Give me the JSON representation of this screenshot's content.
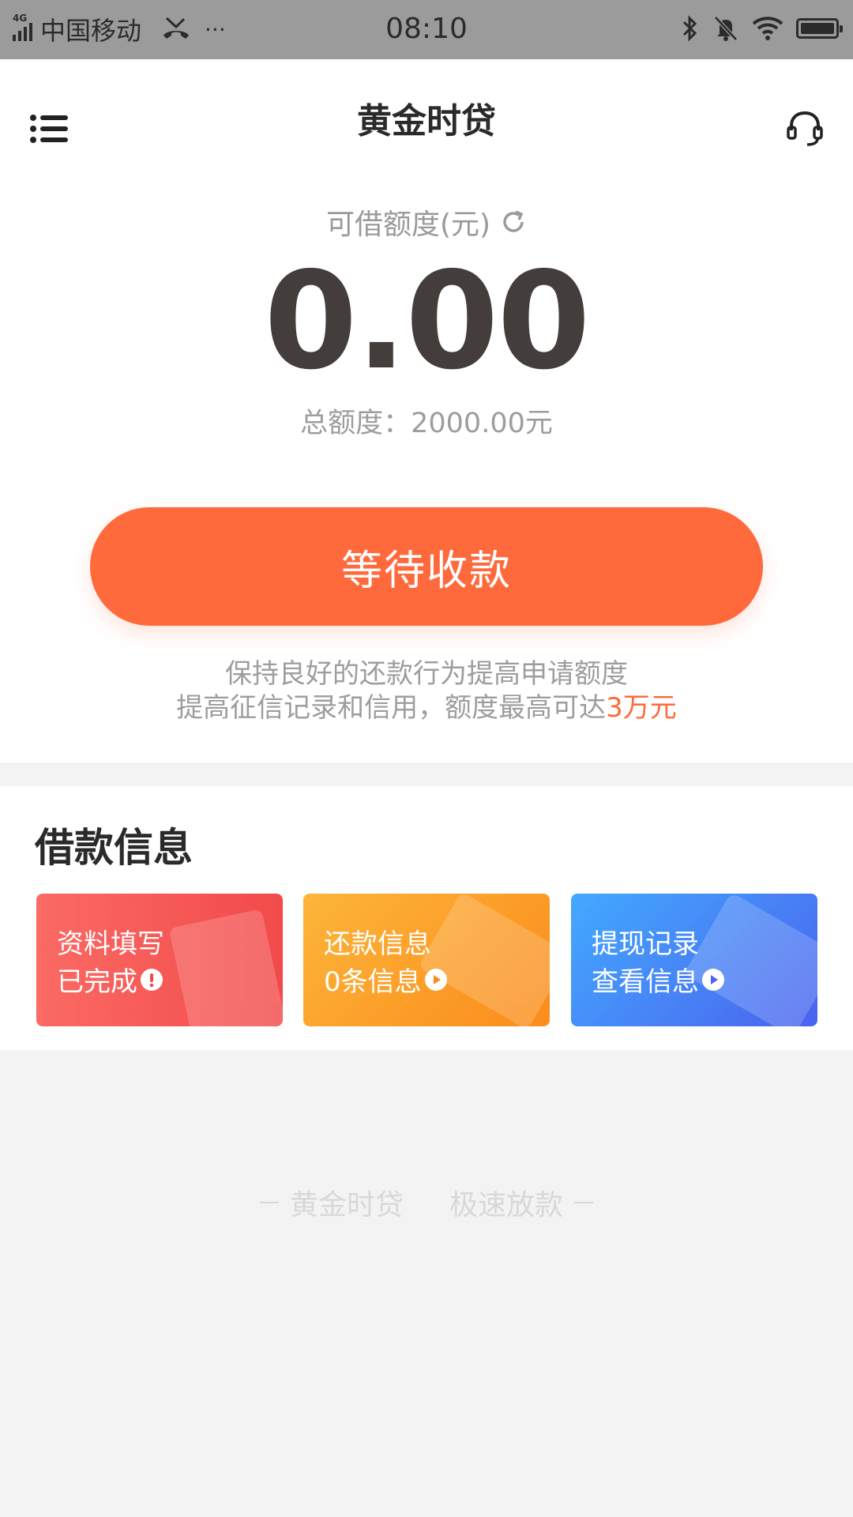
{
  "status_bar": {
    "network": "4G",
    "carrier": "中国移动",
    "more": "···",
    "time": "08:10"
  },
  "header": {
    "title": "黄金时贷"
  },
  "quota": {
    "available_label": "可借额度(元)",
    "available_amount": "0.00",
    "total_text": "总额度：2000.00元"
  },
  "action": {
    "button_label": "等待收款"
  },
  "tips": {
    "line1": "保持良好的还款行为提高申请额度",
    "line2_prefix": "提高征信记录和信用，额度最高可达",
    "line2_highlight": "3万元"
  },
  "loan_info": {
    "section_title": "借款信息",
    "cards": [
      {
        "title": "资料填写",
        "subtitle": "已完成",
        "icon": "exclamation-icon",
        "color": "#f24a4a"
      },
      {
        "title": "还款信息",
        "subtitle": "0条信息",
        "icon": "play-icon",
        "color": "#fb8c1b"
      },
      {
        "title": "提现记录",
        "subtitle": "查看信息",
        "icon": "play-icon",
        "color": "#4a63ee"
      }
    ]
  },
  "footer": {
    "slogan_left": "黄金时贷",
    "slogan_right": "极速放款"
  },
  "colors": {
    "accent": "#ff6a3d",
    "amount_text": "#433d3b"
  }
}
